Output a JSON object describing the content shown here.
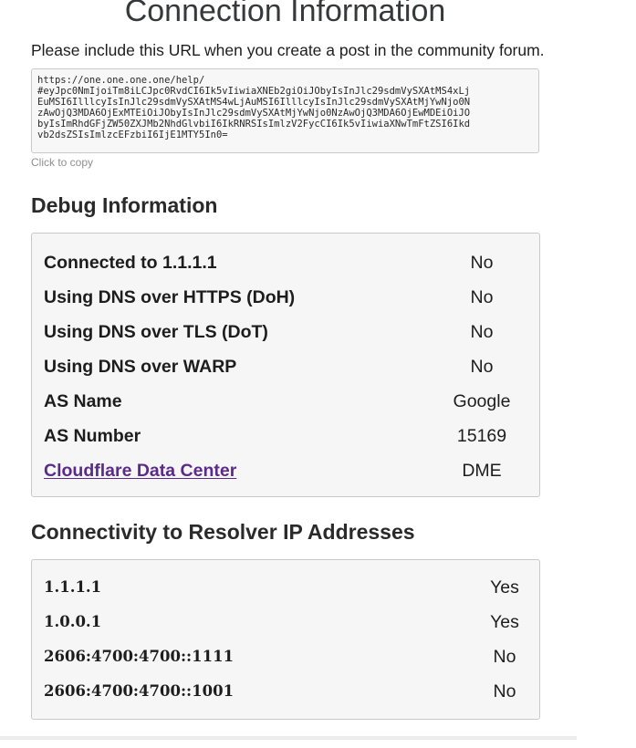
{
  "header": {
    "title": "Connection Information",
    "intro": "Please include this URL when you create a post in the community forum.",
    "url_text": "https://one.one.one.one/help/\n#eyJpc0NmIjoiTm8iLCJpc0RvdCI6Ik5vIiwiaXNEb2giOiJObyIsInJlc29sdmVySXAtMS4xLj\nEuMSI6IlllcyIsInJlc29sdmVySXAtMS4wLjAuMSI6IlllcyIsInJlc29sdmVySXAtMjYwNjo0N\nzAwOjQ3MDA6OjExMTEiOiJObyIsInJlc29sdmVySXAtMjYwNjo0NzAwOjQ3MDA6OjEwMDEiOiJO\nbyIsImRhdGFjZW50ZXJMb2NhdGlvbiI6IkRNRSIsImlzV2FycCI6Ik5vIiwiaXNwTmFtZSI6Ikd\nvb2dsZSIsImlzcEFzbiI6IjE1MTY5In0=",
    "click_to_copy": "Click to copy"
  },
  "debug": {
    "title": "Debug Information",
    "rows": [
      {
        "label": "Connected to 1.1.1.1",
        "value": "No"
      },
      {
        "label": "Using DNS over HTTPS (DoH)",
        "value": "No"
      },
      {
        "label": "Using DNS over TLS (DoT)",
        "value": "No"
      },
      {
        "label": "Using DNS over WARP",
        "value": "No"
      },
      {
        "label": "AS Name",
        "value": "Google"
      },
      {
        "label": "AS Number",
        "value": "15169"
      },
      {
        "label": "Cloudflare Data Center",
        "value": "DME"
      }
    ]
  },
  "resolvers": {
    "title": "Connectivity to Resolver IP Addresses",
    "rows": [
      {
        "label": "1.1.1.1",
        "value": "Yes"
      },
      {
        "label": "1.0.0.1",
        "value": "Yes"
      },
      {
        "label": "2606:4700:4700::1111",
        "value": "No"
      },
      {
        "label": "2606:4700:4700::1001",
        "value": "No"
      }
    ]
  },
  "colors": {
    "link": "#5b2b8a",
    "panel_bg": "#f6f6f6",
    "border": "#c9c9c9"
  }
}
